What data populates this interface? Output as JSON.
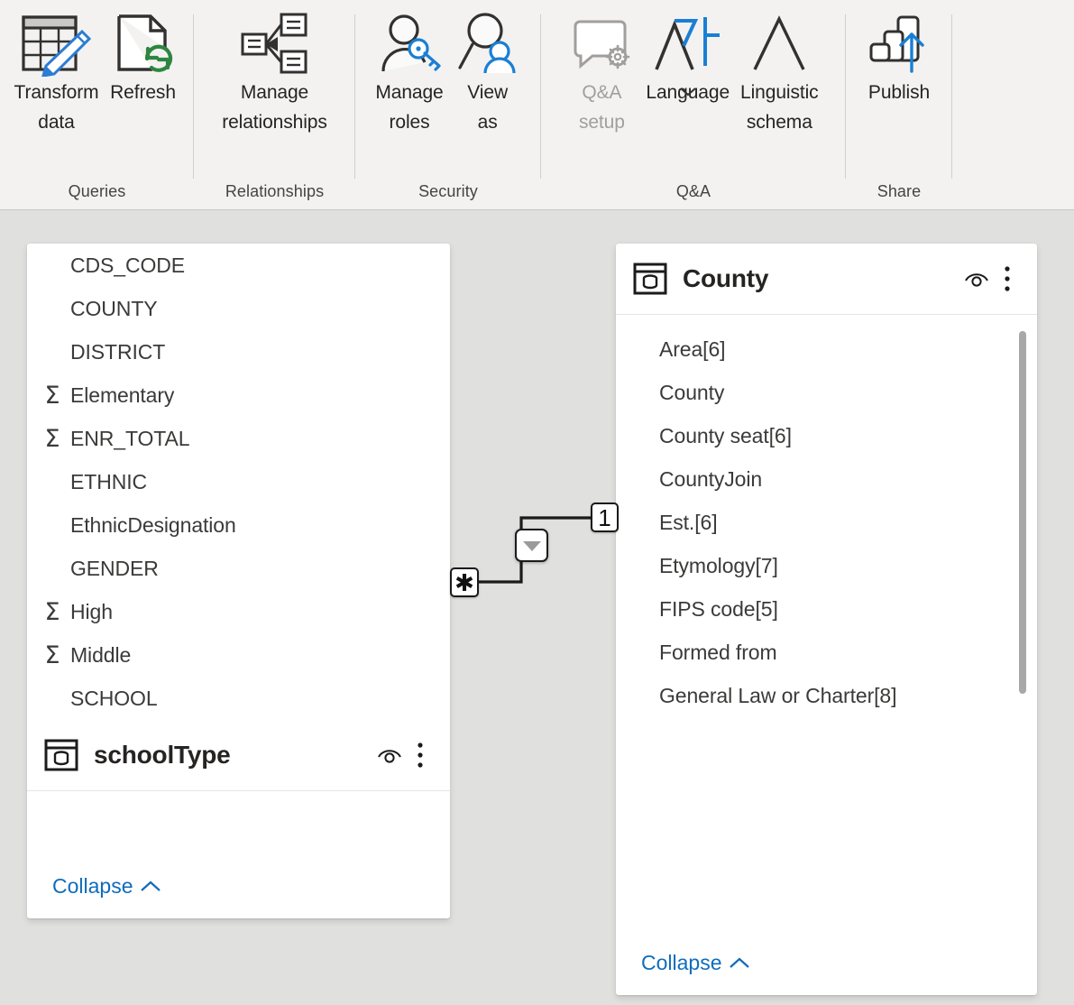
{
  "ribbon": {
    "groups": [
      {
        "name": "queries",
        "label": "Queries",
        "buttons": [
          {
            "name": "transform-data",
            "icon": "table-pencil-icon",
            "label": "Transform\ndata",
            "has_chevron": true,
            "disabled": false
          },
          {
            "name": "refresh",
            "icon": "page-refresh-icon",
            "label": "Refresh",
            "has_chevron": false,
            "disabled": false
          }
        ]
      },
      {
        "name": "relationships",
        "label": "Relationships",
        "buttons": [
          {
            "name": "manage-relationships",
            "icon": "relationships-icon",
            "label": "Manage\nrelationships",
            "has_chevron": false,
            "disabled": false
          }
        ]
      },
      {
        "name": "security",
        "label": "Security",
        "buttons": [
          {
            "name": "manage-roles",
            "icon": "person-key-icon",
            "label": "Manage\nroles",
            "has_chevron": false,
            "disabled": false
          },
          {
            "name": "view-as",
            "icon": "person-search-icon",
            "label": "View\nas",
            "has_chevron": false,
            "disabled": false
          }
        ]
      },
      {
        "name": "qanda",
        "label": "Q&A",
        "buttons": [
          {
            "name": "qanda-setup",
            "icon": "chat-gear-icon",
            "label": "Q&A\nsetup",
            "has_chevron": false,
            "disabled": true
          },
          {
            "name": "language",
            "icon": "language-icon",
            "label": "Language",
            "has_chevron": true,
            "disabled": false
          },
          {
            "name": "linguistic-schema",
            "icon": "letter-a-icon",
            "label": "Linguistic\nschema",
            "has_chevron": true,
            "disabled": false
          }
        ]
      },
      {
        "name": "share",
        "label": "Share",
        "buttons": [
          {
            "name": "publish",
            "icon": "publish-icon",
            "label": "Publish",
            "has_chevron": false,
            "disabled": false
          }
        ]
      }
    ]
  },
  "canvas": {
    "tables": [
      {
        "name": "schoolType",
        "title": "schoolType",
        "icon": "table-database-icon",
        "hide_icon": "eye-hide-icon",
        "more_icon": "more-vertical-icon",
        "collapse_label": "Collapse",
        "collapse_icon": "chevron-up-icon",
        "has_scrollbar": false,
        "fields": [
          {
            "label": "CDS_CODE",
            "aggregate": false
          },
          {
            "label": "COUNTY",
            "aggregate": false
          },
          {
            "label": "DISTRICT",
            "aggregate": false
          },
          {
            "label": "Elementary",
            "aggregate": true
          },
          {
            "label": "ENR_TOTAL",
            "aggregate": true
          },
          {
            "label": "ETHNIC",
            "aggregate": false
          },
          {
            "label": "EthnicDesignation",
            "aggregate": false
          },
          {
            "label": "GENDER",
            "aggregate": false
          },
          {
            "label": "High",
            "aggregate": true
          },
          {
            "label": "Middle",
            "aggregate": true
          },
          {
            "label": "SCHOOL",
            "aggregate": false
          }
        ]
      },
      {
        "name": "County",
        "title": "County",
        "icon": "table-database-icon",
        "hide_icon": "eye-hide-icon",
        "more_icon": "more-vertical-icon",
        "collapse_label": "Collapse",
        "collapse_icon": "chevron-up-icon",
        "has_scrollbar": true,
        "fields": [
          {
            "label": "Area[6]",
            "aggregate": false
          },
          {
            "label": "County",
            "aggregate": false
          },
          {
            "label": "County seat[6]",
            "aggregate": false
          },
          {
            "label": "CountyJoin",
            "aggregate": false
          },
          {
            "label": "Est.[6]",
            "aggregate": false
          },
          {
            "label": "Etymology[7]",
            "aggregate": false
          },
          {
            "label": "FIPS code[5]",
            "aggregate": false
          },
          {
            "label": "Formed from",
            "aggregate": false
          },
          {
            "label": "General Law or Charter[8]",
            "aggregate": false
          }
        ]
      }
    ],
    "relationship": {
      "name": "schoolType-to-county-relationship",
      "many_cardinality": "✱",
      "one_cardinality": "1",
      "direction_icon": "filter-direction-arrow-icon"
    }
  },
  "sigma_glyph": "Σ"
}
